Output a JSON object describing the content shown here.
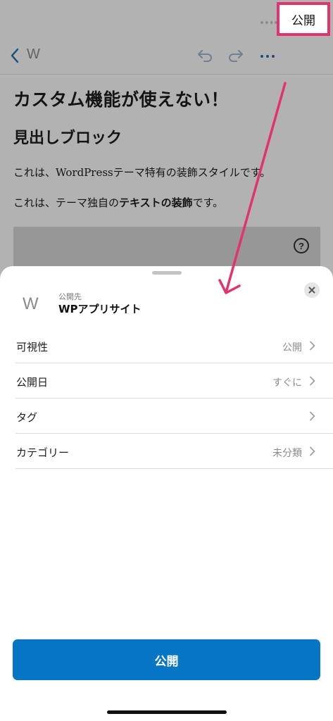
{
  "editor": {
    "site_initial": "W",
    "publish_label": "公開",
    "post_title": "カスタム機能が使えない！",
    "heading_text": "見出しブロック",
    "paragraph_1": "これは、WordPressテーマ特有の装飾スタイルです。",
    "paragraph_2_pre": "これは、テーマ独自の",
    "paragraph_2_bold": "テキストの装飾",
    "paragraph_2_post": "です。",
    "help_glyph": "?"
  },
  "sheet": {
    "site_icon": "W",
    "publish_to_label": "公開先",
    "site_name": "WPアプリサイト",
    "rows": [
      {
        "label": "可視性",
        "value": "公開"
      },
      {
        "label": "公開日",
        "value": "すぐに"
      },
      {
        "label": "タグ",
        "value": ""
      },
      {
        "label": "カテゴリー",
        "value": "未分類"
      }
    ],
    "publish_button_label": "公開"
  },
  "colors": {
    "accent": "#0675c4",
    "toolbar_icons": "#2271b1",
    "annotation": "#e2336b"
  },
  "icons": [
    "wifi-icon",
    "battery-icon",
    "back-chevron-icon",
    "undo-icon",
    "redo-icon",
    "more-icon",
    "help-icon",
    "close-icon",
    "chevron-right-icon"
  ]
}
